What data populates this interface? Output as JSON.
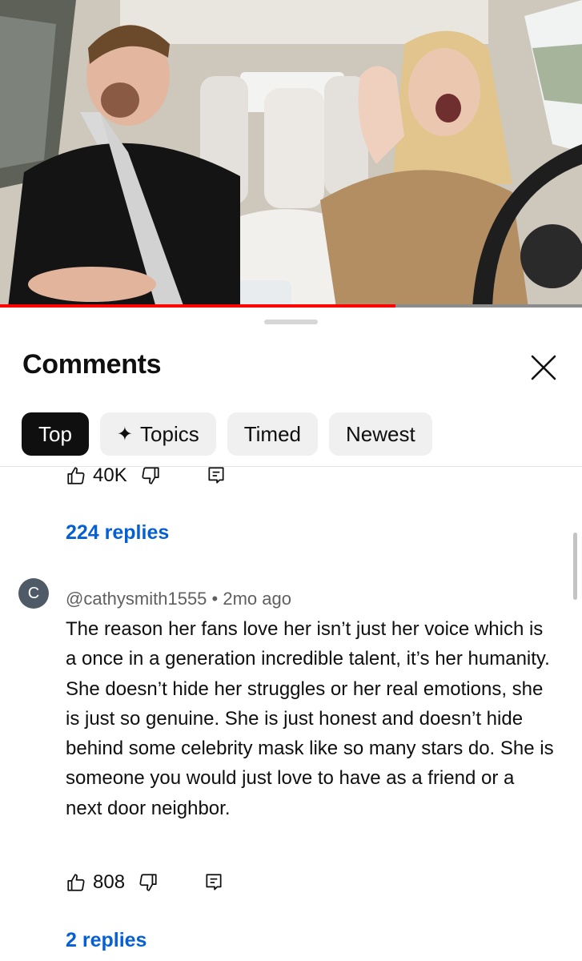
{
  "video": {
    "progress_fraction": 0.68
  },
  "sheet": {
    "title": "Comments",
    "close_icon": "close-icon",
    "chips": [
      {
        "label": "Top",
        "active": true
      },
      {
        "label": "Topics",
        "icon": "sparkle-icon",
        "active": false
      },
      {
        "label": "Timed",
        "active": false
      },
      {
        "label": "Newest",
        "active": false
      }
    ]
  },
  "previous_comment": {
    "like_count": "40K",
    "replies_label": "224 replies"
  },
  "comment": {
    "avatar_letter": "C",
    "author": "@cathysmith1555",
    "separator": "•",
    "time": "2mo ago",
    "text": "The reason her fans love her isn’t just her voice which is a once in a generation incredible talent, it’s her humanity. She doesn’t hide her struggles or her real emotions, she is just so genuine. She is just honest and doesn’t hide behind some celebrity mask like so many stars do. She is someone you would just love to have as a friend or a next door neighbor.",
    "like_count": "808",
    "replies_label": "2 replies"
  },
  "colors": {
    "accent_link": "#065fd4",
    "progress": "#ff0000",
    "chip_active_bg": "#0f0f0f",
    "chip_bg": "#f0f0f0"
  }
}
